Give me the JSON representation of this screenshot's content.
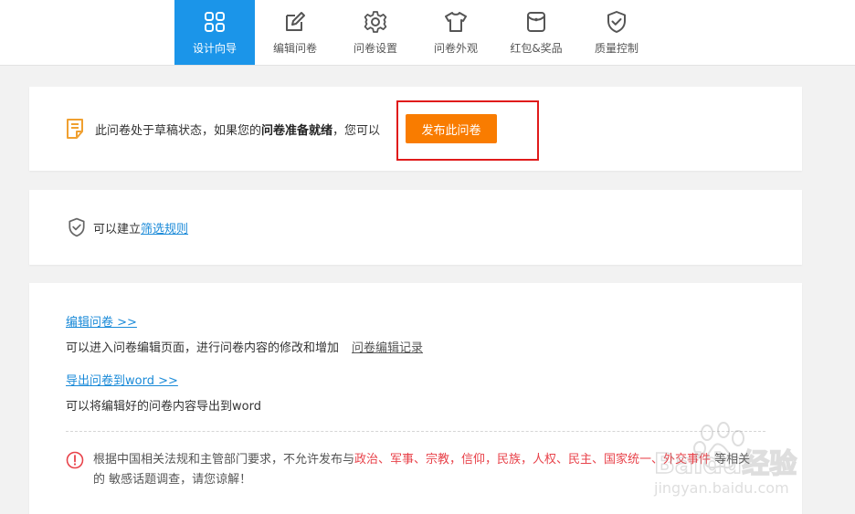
{
  "nav": {
    "items": [
      {
        "label": "设计向导",
        "icon": "grid-icon",
        "active": true
      },
      {
        "label": "编辑问卷",
        "icon": "edit-icon",
        "active": false
      },
      {
        "label": "问卷设置",
        "icon": "gear-icon",
        "active": false
      },
      {
        "label": "问卷外观",
        "icon": "tshirt-icon",
        "active": false
      },
      {
        "label": "红包&奖品",
        "icon": "gift-bag-icon",
        "active": false
      },
      {
        "label": "质量控制",
        "icon": "shield-check-icon",
        "active": false
      }
    ],
    "active_color": "#1b95e9"
  },
  "status_card": {
    "text_before": "此问卷处于草稿状态，如果您的",
    "text_bold": "问卷准备就绪",
    "text_after": "，您可以",
    "publish_label": "发布此问卷",
    "publish_color": "#f97c00",
    "icon": "document-icon"
  },
  "filter_card": {
    "text": "可以建立",
    "link": "筛选规则",
    "icon": "shield-check-icon"
  },
  "actions_card": {
    "edit_link": "编辑问卷 >>",
    "edit_desc": "可以进入问卷编辑页面，进行问卷内容的修改和增加",
    "edit_record_link": "问卷编辑记录",
    "export_link": "导出问卷到word >>",
    "export_desc": "可以将编辑好的问卷内容导出到word",
    "notice": {
      "icon": "exclamation-circle-icon",
      "part1": "根据中国相关法规和主管部门要求，不允许发布与",
      "red1": "政治、军事、宗教，信仰，民族，人权、民主、国家统一、外交事件",
      "part2": " 等相关的 敏感话题调查，请您谅解！"
    }
  },
  "watermark": {
    "brand": "Baidu经验",
    "url": "jingyan.baidu.com"
  }
}
